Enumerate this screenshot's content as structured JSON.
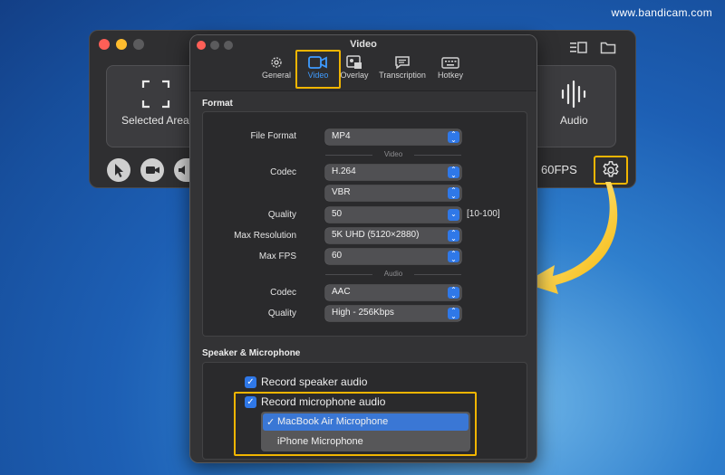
{
  "watermark": "www.bandicam.com",
  "main_window": {
    "modes": {
      "selected_area": "Selected Area",
      "audio": "Audio"
    },
    "fps": "60FPS"
  },
  "dialog": {
    "title": "Video",
    "tabs": [
      {
        "label": "General",
        "icon": "gear-icon"
      },
      {
        "label": "Video",
        "icon": "video-camera-icon",
        "selected": true
      },
      {
        "label": "Overlay",
        "icon": "overlay-icon"
      },
      {
        "label": "Transcription",
        "icon": "chat-bubble-icon"
      },
      {
        "label": "Hotkey",
        "icon": "keyboard-icon"
      }
    ],
    "format": {
      "heading": "Format",
      "file_format_label": "File Format",
      "file_format_value": "MP4",
      "video_sep": "Video",
      "codec_label": "Codec",
      "codec_value": "H.264",
      "bitrate_mode_value": "VBR",
      "quality_label": "Quality",
      "quality_value": "50",
      "quality_range": "[10-100]",
      "max_res_label": "Max Resolution",
      "max_res_value": "5K UHD (5120×2880)",
      "max_fps_label": "Max FPS",
      "max_fps_value": "60",
      "audio_sep": "Audio",
      "audio_codec_label": "Codec",
      "audio_codec_value": "AAC",
      "audio_quality_label": "Quality",
      "audio_quality_value": "High - 256Kbps"
    },
    "speaker_mic": {
      "heading": "Speaker & Microphone",
      "record_speaker": "Record speaker audio",
      "record_mic": "Record microphone audio",
      "mic_options": [
        "MacBook Air Microphone",
        "iPhone Microphone"
      ],
      "mic_selected": "MacBook Air Microphone",
      "check_glyph": "✓"
    }
  },
  "colors": {
    "accent": "#2f78e8",
    "highlight": "#f1b500"
  }
}
